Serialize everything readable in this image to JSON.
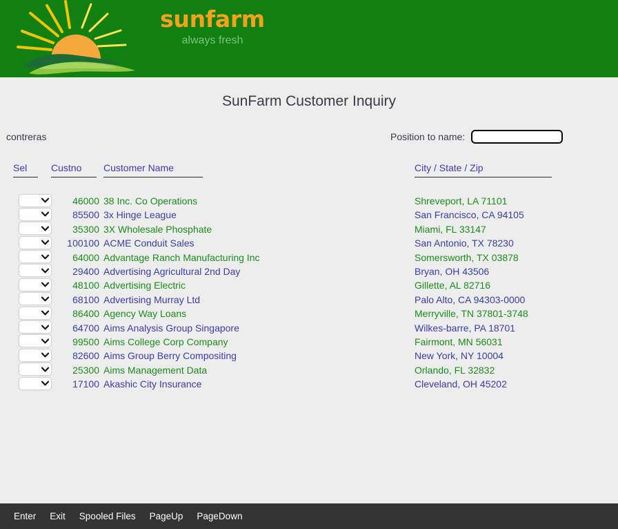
{
  "brand": {
    "name": "sunfarm",
    "tagline": "always fresh",
    "banner_color": "#118011",
    "name_color": "#f5a219",
    "tagline_color": "#7cc47c",
    "logo_icon": "sun-over-field-icon"
  },
  "page": {
    "title": "SunFarm Customer Inquiry",
    "background_color": "#ededed"
  },
  "user": {
    "name": "contreras"
  },
  "search": {
    "label": "Position to name:",
    "value": "",
    "placeholder": ""
  },
  "grid": {
    "columns": [
      {
        "key": "sel",
        "label": "Sel"
      },
      {
        "key": "custno",
        "label": "Custno"
      },
      {
        "key": "name",
        "label": "Customer Name"
      },
      {
        "key": "city",
        "label": "City / State / Zip"
      }
    ],
    "select_placeholder": "",
    "select_chevron_icon": "chevron-down-icon",
    "row_colors": {
      "green": "#1a8f1a",
      "blue": "#3b3bb5"
    },
    "rows": [
      {
        "custno": "46000",
        "name": "38 Inc. Co Operations",
        "city": "Shreveport, LA 71101",
        "color": "green"
      },
      {
        "custno": "85500",
        "name": "3x Hinge League",
        "city": "San Francisco, CA 94105",
        "color": "blue"
      },
      {
        "custno": "35300",
        "name": "3X Wholesale Phosphate",
        "city": "Miami, FL 33147",
        "color": "green"
      },
      {
        "custno": "100100",
        "name": "ACME Conduit Sales",
        "city": "San Antonio, TX 78230",
        "color": "blue"
      },
      {
        "custno": "64000",
        "name": "Advantage Ranch Manufacturing Inc",
        "city": "Somersworth, TX 03878",
        "color": "green"
      },
      {
        "custno": "29400",
        "name": "Advertising Agricultural 2nd Day",
        "city": "Bryan, OH 43506",
        "color": "blue"
      },
      {
        "custno": "48100",
        "name": "Advertising Electric",
        "city": "Gillette, AL 82716",
        "color": "green"
      },
      {
        "custno": "68100",
        "name": "Advertising Murray Ltd",
        "city": "Palo Alto, CA 94303-0000",
        "color": "blue"
      },
      {
        "custno": "86400",
        "name": "Agency Way Loans",
        "city": "Merryville, TN 37801-3748",
        "color": "green"
      },
      {
        "custno": "64700",
        "name": "Aims Analysis Group Singapore",
        "city": "Wilkes-barre, PA 18701",
        "color": "blue"
      },
      {
        "custno": "99500",
        "name": "Aims College Corp Company",
        "city": "Fairmont, MN 56031",
        "color": "green"
      },
      {
        "custno": "82600",
        "name": "Aims Group Berry Compositing",
        "city": "New York, NY 10004",
        "color": "blue"
      },
      {
        "custno": "25300",
        "name": "Aims Management Data",
        "city": "Orlando, FL 32832",
        "color": "green"
      },
      {
        "custno": "17100",
        "name": "Akashic City Insurance",
        "city": "Cleveland, OH 45202",
        "color": "blue"
      }
    ]
  },
  "footer": {
    "background_color": "#333333",
    "keys": [
      {
        "label": "Enter"
      },
      {
        "label": "Exit"
      },
      {
        "label": "Spooled Files"
      },
      {
        "label": "PageUp"
      },
      {
        "label": "PageDown"
      }
    ]
  }
}
